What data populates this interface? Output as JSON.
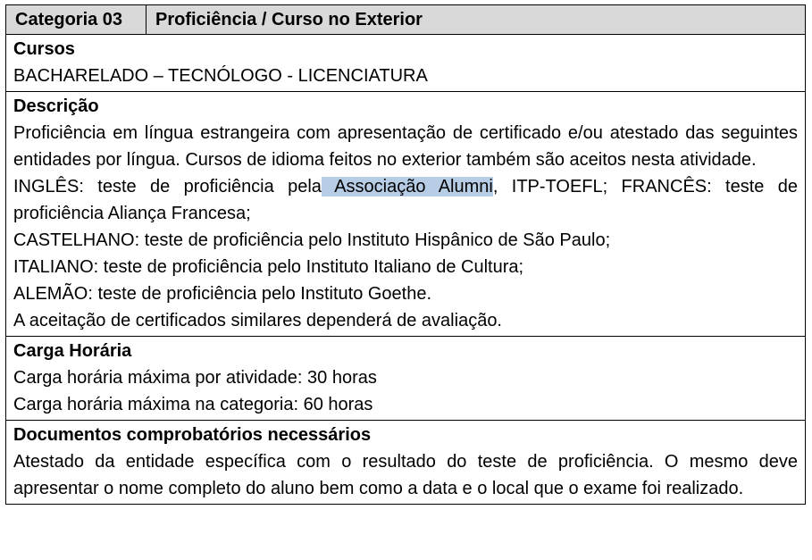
{
  "header": {
    "category": "Categoria 03",
    "title": "Proficiência / Curso no Exterior"
  },
  "cursos": {
    "heading": "Cursos",
    "value": "BACHARELADO – TECNÓLOGO - LICENCIATURA"
  },
  "descricao": {
    "heading": "Descrição",
    "paragraph1": "Proficiência em língua estrangeira com apresentação de certificado e/ou atestado das seguintes entidades por língua. Cursos de idioma feitos no exterior também são aceitos nesta atividade.",
    "ingles_prefix": "INGLÊS: teste de proficiência pela",
    "ingles_highlight": " Associação Alumni",
    "ingles_suffix": ", ITP-TOEFL; FRANCÊS: teste de proficiência Aliança Francesa;",
    "castelhano": "CASTELHANO: teste de proficiência pelo Instituto Hispânico de São Paulo;",
    "italiano": "ITALIANO: teste de proficiência pelo Instituto Italiano de Cultura;",
    "alemao": "ALEMÃO: teste de proficiência pelo Instituto Goethe.",
    "aceitacao": "A aceitação de certificados similares dependerá de avaliação."
  },
  "carga": {
    "heading": "Carga Horária",
    "line1": "Carga horária máxima por atividade: 30 horas",
    "line2": "Carga horária máxima na categoria: 60 horas"
  },
  "documentos": {
    "heading": "Documentos comprobatórios necessários",
    "text": "Atestado da entidade específica com o resultado do teste de proficiência. O mesmo deve apresentar o nome completo do aluno bem como a data e o local que o exame foi realizado."
  },
  "colors": {
    "header_bg": "#d9d9d9",
    "highlight": "#b7cde5"
  }
}
